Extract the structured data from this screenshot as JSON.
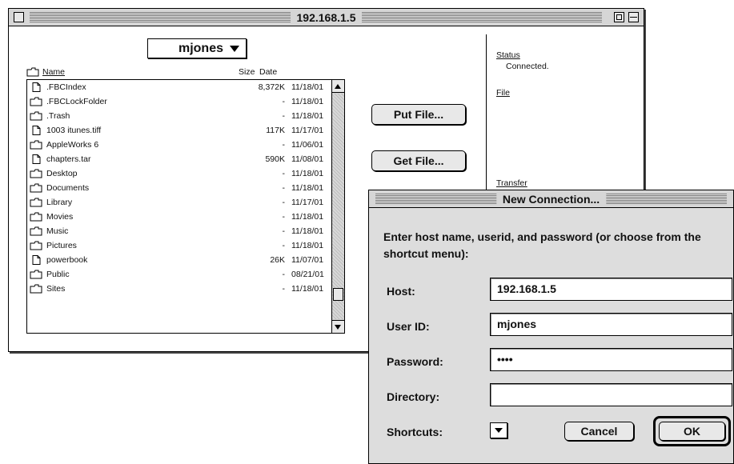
{
  "main_window": {
    "title": "192.168.1.5",
    "folder_popup": "mjones",
    "columns": {
      "name": "Name",
      "size": "Size",
      "date": "Date"
    },
    "files": [
      {
        "icon": "document-icon",
        "name": ".FBCIndex",
        "size": "8,372K",
        "date": "11/18/01"
      },
      {
        "icon": "folder-icon",
        "name": ".FBCLockFolder",
        "size": "-",
        "date": "11/18/01"
      },
      {
        "icon": "folder-icon",
        "name": ".Trash",
        "size": "-",
        "date": "11/18/01"
      },
      {
        "icon": "document-icon",
        "name": "1003 itunes.tiff",
        "size": "117K",
        "date": "11/17/01"
      },
      {
        "icon": "folder-icon",
        "name": "AppleWorks 6",
        "size": "-",
        "date": "11/06/01"
      },
      {
        "icon": "document-icon",
        "name": "chapters.tar",
        "size": "590K",
        "date": "11/08/01"
      },
      {
        "icon": "folder-icon",
        "name": "Desktop",
        "size": "-",
        "date": "11/18/01"
      },
      {
        "icon": "folder-icon",
        "name": "Documents",
        "size": "-",
        "date": "11/18/01"
      },
      {
        "icon": "folder-icon",
        "name": "Library",
        "size": "-",
        "date": "11/17/01"
      },
      {
        "icon": "folder-icon",
        "name": "Movies",
        "size": "-",
        "date": "11/18/01"
      },
      {
        "icon": "folder-icon",
        "name": "Music",
        "size": "-",
        "date": "11/18/01"
      },
      {
        "icon": "folder-icon",
        "name": "Pictures",
        "size": "-",
        "date": "11/18/01"
      },
      {
        "icon": "document-icon",
        "name": "powerbook",
        "size": "26K",
        "date": "11/07/01"
      },
      {
        "icon": "folder-icon",
        "name": "Public",
        "size": "-",
        "date": "08/21/01"
      },
      {
        "icon": "folder-icon",
        "name": "Sites",
        "size": "-",
        "date": "11/18/01"
      }
    ],
    "scroll_position": 0.92,
    "buttons": {
      "put": "Put File...",
      "get": "Get File..."
    },
    "status_panel": {
      "status_label": "Status",
      "status_value": "Connected.",
      "file_label": "File",
      "transfer_label": "Transfer"
    }
  },
  "dialog": {
    "title": "New Connection...",
    "prompt": "Enter host name, userid, and password (or choose from the shortcut menu):",
    "host_label": "Host:",
    "host_value": "192.168.1.5",
    "user_label": "User ID:",
    "user_value": "mjones",
    "password_label": "Password:",
    "password_value": "••••",
    "directory_label": "Directory:",
    "directory_value": "",
    "shortcuts_label": "Shortcuts:",
    "cancel": "Cancel",
    "ok": "OK"
  }
}
